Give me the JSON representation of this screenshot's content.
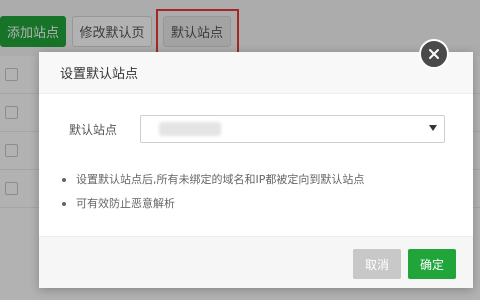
{
  "toolbar": {
    "add_site": "添加站点",
    "edit_default_page": "修改默认页",
    "default_site": "默认站点"
  },
  "modal": {
    "title": "设置默认站点",
    "field_label": "默认站点",
    "select_value": "",
    "tips": [
      "设置默认站点后,所有未绑定的域名和IP都被定向到默认站点",
      "可有效防止恶意解析"
    ],
    "cancel": "取消",
    "confirm": "确定"
  },
  "colors": {
    "primary_green": "#20a53a",
    "highlight_red": "#e83a3a",
    "cancel_gray": "#c8c8c8"
  }
}
